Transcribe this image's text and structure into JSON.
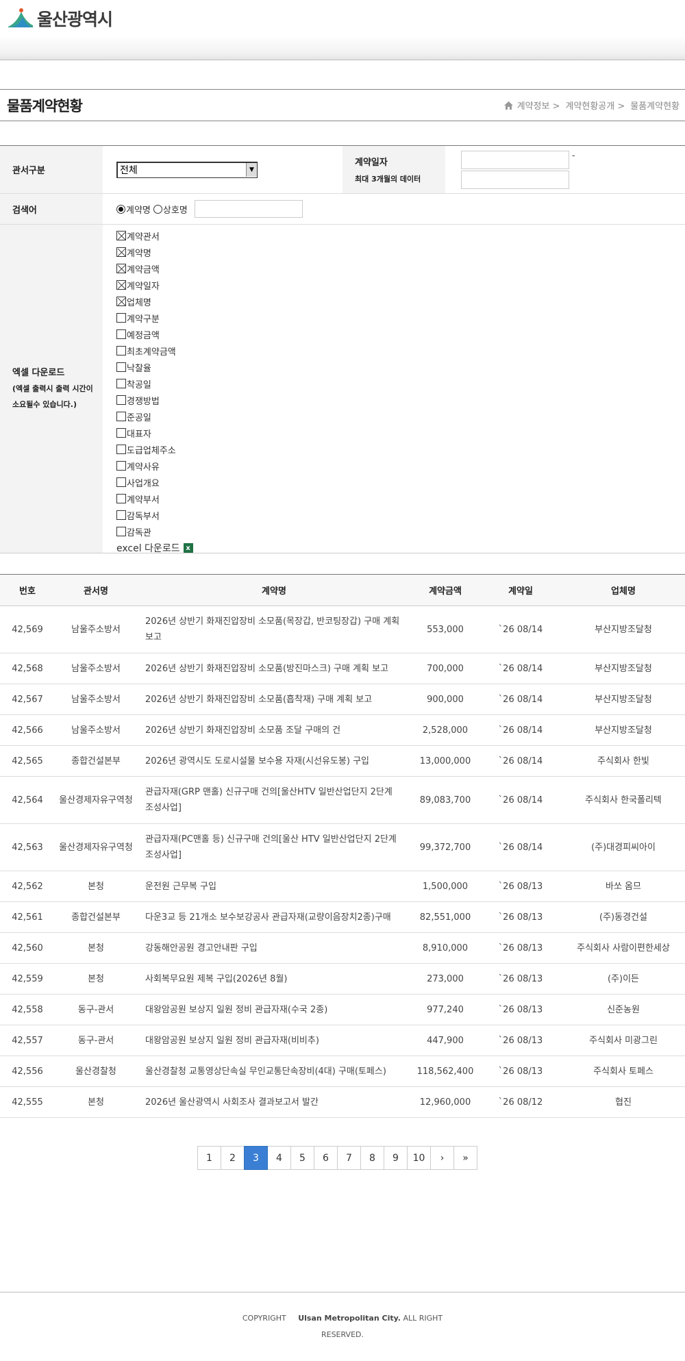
{
  "header": {
    "logo_text": "울산광역시"
  },
  "page": {
    "title": "물품계약현황",
    "breadcrumb": [
      "계약정보 >",
      "계약현황공개 >",
      "물품계약현황"
    ]
  },
  "form": {
    "office_label": "관서구분",
    "office_value": "전체",
    "date_label": "계약일자",
    "date_note": "최대 3개월의 데이터",
    "date_sep": "-",
    "keyword_label": "검색어",
    "radio_contract": "계약명",
    "radio_company": "상호명",
    "excel_label": "엑셀 다운로드",
    "excel_note": "(엑셀 출력시 출력 시간이 소요될수 있습니다.)",
    "excel_download": "excel 다운로드",
    "checkboxes": [
      {
        "label": "계약관서",
        "checked": true
      },
      {
        "label": "계약명",
        "checked": true
      },
      {
        "label": "계약금액",
        "checked": true
      },
      {
        "label": "계약일자",
        "checked": true
      },
      {
        "label": "업체명",
        "checked": true
      },
      {
        "label": "계약구분",
        "checked": false
      },
      {
        "label": "예정금액",
        "checked": false
      },
      {
        "label": "최초계약금액",
        "checked": false
      },
      {
        "label": "낙찰율",
        "checked": false
      },
      {
        "label": "착공일",
        "checked": false
      },
      {
        "label": "경쟁방법",
        "checked": false
      },
      {
        "label": "준공일",
        "checked": false
      },
      {
        "label": "대표자",
        "checked": false
      },
      {
        "label": "도급업체주소",
        "checked": false
      },
      {
        "label": "계약사유",
        "checked": false
      },
      {
        "label": "사업개요",
        "checked": false
      },
      {
        "label": "계약부서",
        "checked": false
      },
      {
        "label": "감독부서",
        "checked": false
      },
      {
        "label": "감독관",
        "checked": false
      }
    ]
  },
  "table": {
    "headers": [
      "번호",
      "관서명",
      "계약명",
      "계약금액",
      "계약일",
      "업체명"
    ],
    "rows": [
      [
        "42,569",
        "남울주소방서",
        "2026년 상반기 화재진압장비 소모품(목장갑, 반코팅장갑) 구매 계획 보고",
        "553,000",
        "`26 08/14",
        "부산지방조달청"
      ],
      [
        "42,568",
        "남울주소방서",
        "2026년 상반기 화재진압장비 소모품(방진마스크) 구매 계획 보고",
        "700,000",
        "`26 08/14",
        "부산지방조달청"
      ],
      [
        "42,567",
        "남울주소방서",
        "2026년 상반기 화재진압장비 소모품(흡착재) 구매 계획 보고",
        "900,000",
        "`26 08/14",
        "부산지방조달청"
      ],
      [
        "42,566",
        "남울주소방서",
        "2026년 상반기 화재진압장비 소모품 조달 구매의 건",
        "2,528,000",
        "`26 08/14",
        "부산지방조달청"
      ],
      [
        "42,565",
        "종합건설본부",
        "2026년 광역시도 도로시설물 보수용 자재(시선유도봉) 구입",
        "13,000,000",
        "`26 08/14",
        "주식회사 한빛"
      ],
      [
        "42,564",
        "울산경제자유구역청",
        "관급자재(GRP 맨홀) 신규구매 건의[울산HTV 일반산업단지 2단계 조성사업]",
        "89,083,700",
        "`26 08/14",
        "주식회사 한국폴리텍"
      ],
      [
        "42,563",
        "울산경제자유구역청",
        "관급자재(PC맨홀 등) 신규구매 건의[울산 HTV 일반산업단지 2단계 조성사업]",
        "99,372,700",
        "`26 08/14",
        "(주)대경피씨아이"
      ],
      [
        "42,562",
        "본청",
        "운전원 근무복 구입",
        "1,500,000",
        "`26 08/13",
        "바쏘 옴므"
      ],
      [
        "42,561",
        "종합건설본부",
        "다운3교 등 21개소 보수보강공사 관급자재(교량이음장치2종)구매",
        "82,551,000",
        "`26 08/13",
        "(주)동경건설"
      ],
      [
        "42,560",
        "본청",
        "강동해안공원 경고안내판 구입",
        "8,910,000",
        "`26 08/13",
        "주식회사 사람이편한세상"
      ],
      [
        "42,559",
        "본청",
        "사회복무요원 제복 구입(2026년 8월)",
        "273,000",
        "`26 08/13",
        "(주)이든"
      ],
      [
        "42,558",
        "동구-관서",
        "대왕암공원 보상지 일원 정비 관급자재(수국 2종)",
        "977,240",
        "`26 08/13",
        "신준농원"
      ],
      [
        "42,557",
        "동구-관서",
        "대왕암공원 보상지 일원 정비 관급자재(비비추)",
        "447,900",
        "`26 08/13",
        "주식회사 미광그린"
      ],
      [
        "42,556",
        "울산경찰청",
        "울산경찰청 교통영상단속실 무인교통단속장비(4대) 구매(토페스)",
        "118,562,400",
        "`26 08/13",
        "주식회사 토페스"
      ],
      [
        "42,555",
        "본청",
        "2026년 울산광역시 사회조사 결과보고서 발간",
        "12,960,000",
        "`26 08/12",
        "협진"
      ]
    ]
  },
  "pagination": {
    "pages": [
      "1",
      "2",
      "3",
      "4",
      "5",
      "6",
      "7",
      "8",
      "9",
      "10"
    ],
    "current": "3",
    "next": "›",
    "last": "»"
  },
  "footer": {
    "copyright": "COPYRIGHT",
    "org": "Ulsan Metropolitan City.",
    "rights": "ALL RIGHT RESERVED."
  },
  "colors": {
    "active_page": "#3a7fd4",
    "logo_blue": "#2e8fc4",
    "logo_green": "#3aa58a",
    "excel_green": "#1f7244"
  }
}
